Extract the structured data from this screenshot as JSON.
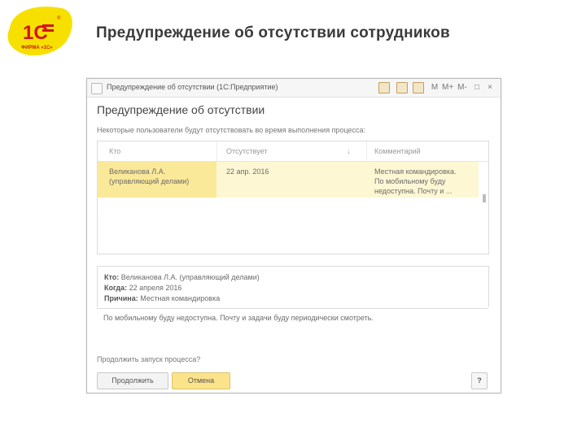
{
  "slide": {
    "title": "Предупреждение об отсутствии сотрудников",
    "logo": {
      "main": "1С",
      "sub": "ФИРМА «1С»",
      "colors": {
        "bg": "#f7e000",
        "text": "#d4141c"
      }
    }
  },
  "window": {
    "title": "Предупреждение об отсутствии (1С:Предприятие)",
    "controls": [
      "М",
      "М+",
      "М-",
      "□",
      "×"
    ]
  },
  "form": {
    "title": "Предупреждение об отсутствии",
    "hint": "Некоторые пользователи будут отсутствовать во время выполнения процесса:",
    "table": {
      "columns": [
        "Кто",
        "Отсутствует",
        "↓",
        "Комментарий"
      ],
      "rows": [
        {
          "who_line1": "Великанова Л.А.",
          "who_line2": "(управляющий делами)",
          "absent": "22 апр. 2016",
          "comment_line1": "Местная командировка.",
          "comment_line2": "По мобильному буду",
          "comment_line3": "недоступна. Почту и ..."
        }
      ]
    },
    "detail": {
      "who_label": "Кто:",
      "who_value": "Великанова Л.А. (управляющий делами)",
      "when_label": "Когда:",
      "when_value": "22 апреля 2016",
      "reason_label": "Причина:",
      "reason_value": "Местная командировка"
    },
    "comment": "По мобильному буду недоступна. Почту и задачи буду периодически смотреть.",
    "question": "Продолжить запуск процесса?",
    "buttons": {
      "continue": "Продолжить",
      "cancel": "Отмена",
      "help": "?"
    }
  }
}
